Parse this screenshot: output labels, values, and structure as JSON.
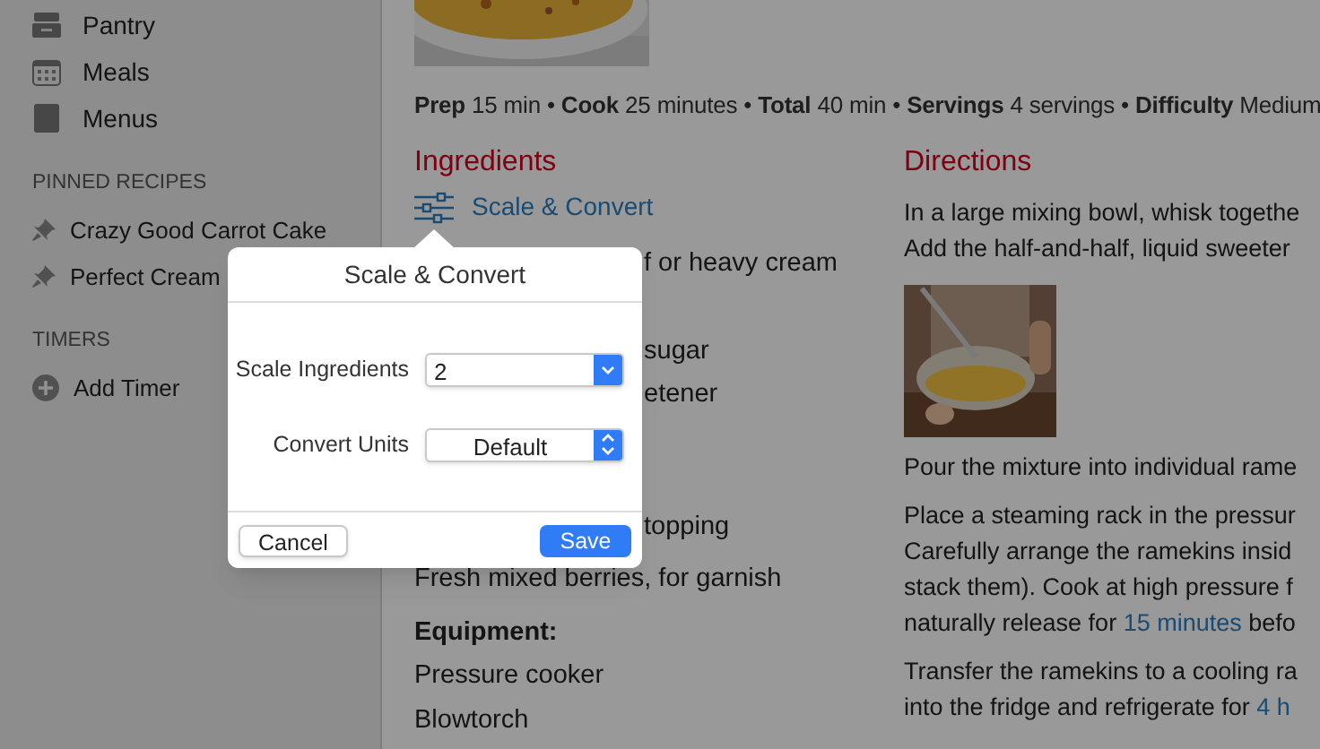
{
  "sidebar": {
    "items": [
      {
        "label": "Pantry"
      },
      {
        "label": "Meals"
      },
      {
        "label": "Menus"
      }
    ],
    "sections": [
      {
        "title": "PINNED RECIPES",
        "items": [
          {
            "label": "Crazy Good Carrot Cake",
            "kind": "pin"
          },
          {
            "label": "Perfect Cream",
            "kind": "pin"
          }
        ]
      },
      {
        "title": "TIMERS",
        "items": [
          {
            "label": "Add Timer",
            "kind": "add"
          }
        ]
      }
    ]
  },
  "recipe": {
    "meta": "**Prep** 15 min • **Cook** 25 minutes • **Total** 40 min • **Servings** 4 servings • **Difficulty** Medium",
    "ingredients_title": "Ingredients",
    "scale_link": "Scale & Convert",
    "ingredients": [
      {
        "text": "f or heavy cream",
        "kind": "cut"
      },
      {
        "kind": "cut"
      },
      {
        "text": "sugar",
        "kind": "cut"
      },
      {
        "text": "etener",
        "kind": "cut"
      },
      {
        "kind": "cut"
      },
      {
        "kind": "cut"
      },
      {
        "text": "topping",
        "kind": "cut"
      },
      {
        "text": "Fresh mixed berries, for garnish",
        "kind": "whole"
      }
    ],
    "equipment_title": "Equipment:",
    "equipment": [
      "Pressure cooker",
      "Blowtorch"
    ],
    "directions_title": "Directions",
    "directions": [
      {
        "kind": "text",
        "lines": [
          [
            {
              "text": "In a large mixing bowl, whisk togethe"
            }
          ],
          [
            {
              "text": "Add the half-and-half, liquid sweeter"
            }
          ]
        ]
      },
      {
        "kind": "picture"
      },
      {
        "kind": "text",
        "lines": [
          [
            {
              "text": "Pour the mixture into individual rame"
            }
          ]
        ]
      },
      {
        "kind": "text",
        "lines": [
          [
            {
              "text": "Place a steaming rack in the pressur"
            }
          ],
          [
            {
              "text": "Carefully arrange the ramekins insid"
            }
          ],
          [
            {
              "text": "stack them). Cook at high pressure f"
            }
          ],
          [
            {
              "text": "naturally release for "
            },
            {
              "text": "15 minutes",
              "link": true
            },
            {
              "text": " befo"
            }
          ]
        ]
      },
      {
        "kind": "text",
        "lines": [
          [
            {
              "text": "Transfer the ramekins to a cooling ra"
            }
          ],
          [
            {
              "text": "into the fridge and refrigerate for "
            },
            {
              "text": "4 h",
              "link": true
            }
          ]
        ]
      }
    ]
  },
  "dialog": {
    "title": "Scale & Convert",
    "scale_label": "Scale Ingredients",
    "scale_value": "2",
    "units_label": "Convert Units",
    "units_value": "Default",
    "cancel": "Cancel",
    "save": "Save"
  }
}
